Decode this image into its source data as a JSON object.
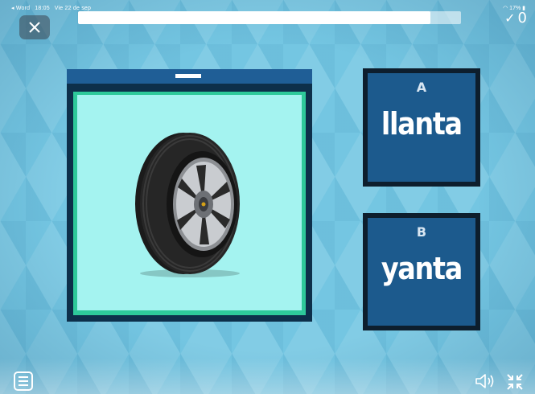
{
  "status_bar": {
    "back_app": "◂ Word",
    "time": "18:05",
    "date": "Vie 22 de sep",
    "battery": "17%"
  },
  "progress": {
    "fraction": 0.92
  },
  "score": {
    "value": "0"
  },
  "question": {
    "image": "tire-icon"
  },
  "answers": [
    {
      "letter": "A",
      "word": "llanta"
    },
    {
      "letter": "B",
      "word": "yanta"
    }
  ],
  "colors": {
    "background": "#74c6e2",
    "card_dark": "#0d2f4a",
    "card_header": "#1f5e96",
    "frame_green": "#2ec99a",
    "image_bg": "#a4f3f0",
    "answer_bg": "#1c5a8d"
  },
  "icons": {
    "close": "close-icon",
    "menu": "menu-icon",
    "sound": "speaker-icon",
    "collapse": "collapse-icon",
    "score": "check-icon"
  }
}
